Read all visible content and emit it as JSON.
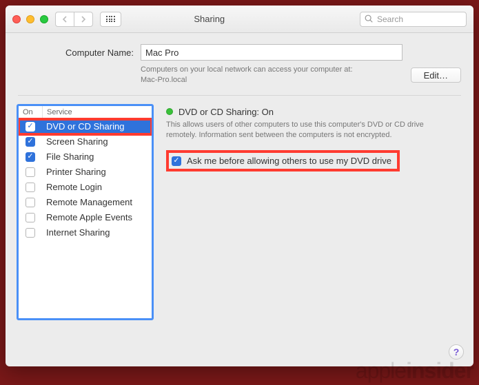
{
  "window": {
    "title": "Sharing",
    "search_placeholder": "Search"
  },
  "computerName": {
    "label": "Computer Name:",
    "value": "Mac Pro",
    "description_line1": "Computers on your local network can access your computer at:",
    "description_line2": "Mac-Pro.local",
    "edit_button": "Edit…"
  },
  "services": {
    "header_on": "On",
    "header_service": "Service",
    "items": [
      {
        "label": "DVD or CD Sharing",
        "checked": true,
        "selected": true,
        "highlighted": true
      },
      {
        "label": "Screen Sharing",
        "checked": true,
        "selected": false,
        "highlighted": false
      },
      {
        "label": "File Sharing",
        "checked": true,
        "selected": false,
        "highlighted": false
      },
      {
        "label": "Printer Sharing",
        "checked": false,
        "selected": false,
        "highlighted": false
      },
      {
        "label": "Remote Login",
        "checked": false,
        "selected": false,
        "highlighted": false
      },
      {
        "label": "Remote Management",
        "checked": false,
        "selected": false,
        "highlighted": false
      },
      {
        "label": "Remote Apple Events",
        "checked": false,
        "selected": false,
        "highlighted": false
      },
      {
        "label": "Internet Sharing",
        "checked": false,
        "selected": false,
        "highlighted": false
      }
    ]
  },
  "detail": {
    "status_color": "#3ac13a",
    "title": "DVD or CD Sharing: On",
    "description": "This allows users of other computers to use this computer's DVD or CD drive remotely. Information sent between the computers is not encrypted.",
    "ask_checkbox_label": "Ask me before allowing others to use my DVD drive",
    "ask_checked": true
  },
  "help_label": "?",
  "watermark": {
    "light": "apple",
    "bold": "insider"
  }
}
